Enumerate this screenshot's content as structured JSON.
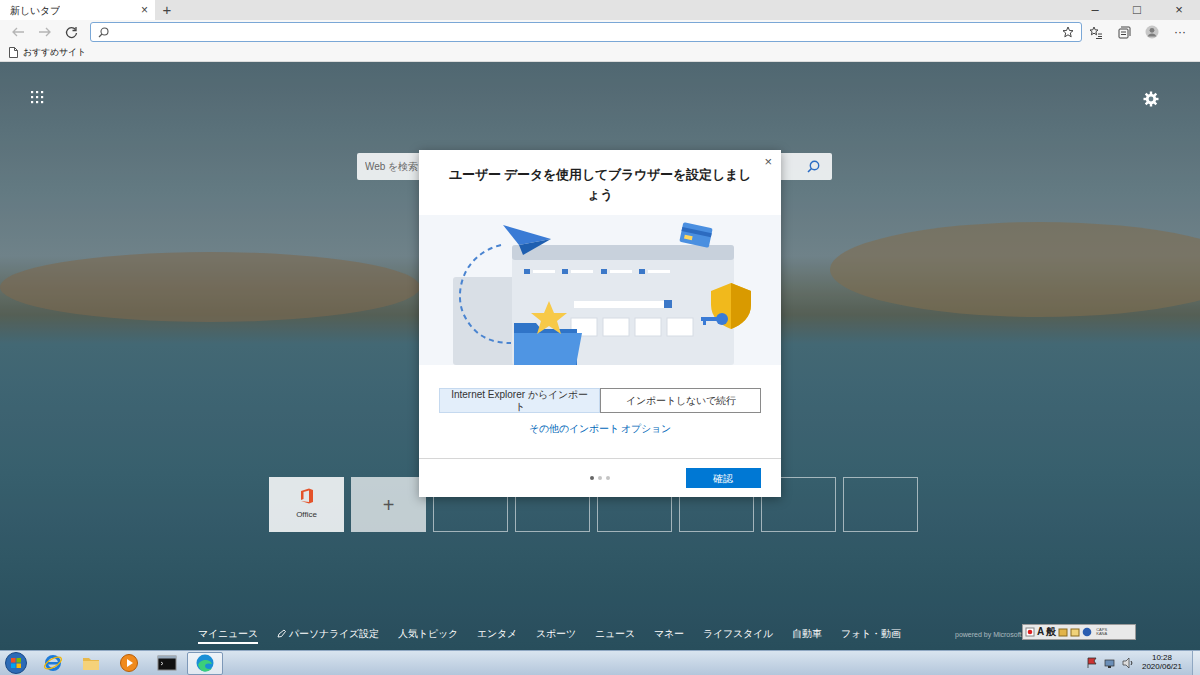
{
  "browser": {
    "tabs": [
      {
        "label": "新しいタブ",
        "selected": true,
        "close": "×"
      }
    ],
    "new_tab": "+",
    "window_controls": [
      "–",
      "□",
      "×"
    ],
    "toolbar_more": "···",
    "favorites": [
      "おすすめサイト"
    ]
  },
  "newtab": {
    "search": {
      "placeholder": "Web を検索"
    },
    "quick_links": [
      {
        "kind": "app",
        "label": "Office"
      },
      {
        "kind": "add",
        "label": "+"
      },
      {
        "kind": "empty"
      },
      {
        "kind": "empty"
      },
      {
        "kind": "empty"
      },
      {
        "kind": "empty"
      },
      {
        "kind": "empty"
      },
      {
        "kind": "empty"
      }
    ]
  },
  "dialog": {
    "title": "ユーザー データを使用してブラウザーを設定しましょう",
    "close": "×",
    "options": [
      {
        "label": "Internet Explorer からインポート",
        "selected": true
      },
      {
        "label": "インポートしないで続行",
        "selected": false
      }
    ],
    "link": "その他のインポート オプション",
    "steps": [
      {
        "active": true
      },
      {
        "active": false
      },
      {
        "active": false
      }
    ],
    "confirm": "確認"
  },
  "news_nav": {
    "items": [
      {
        "label": "マイニュース",
        "selected": true,
        "kind": "tab"
      },
      {
        "label": "パーソナライズ設定",
        "selected": false,
        "kind": "action"
      },
      {
        "label": "人気トピック",
        "selected": false,
        "kind": "tab"
      },
      {
        "label": "エンタメ",
        "selected": false,
        "kind": "tab"
      },
      {
        "label": "スポーツ",
        "selected": false,
        "kind": "tab"
      },
      {
        "label": "ニュース",
        "selected": false,
        "kind": "tab"
      },
      {
        "label": "マネー",
        "selected": false,
        "kind": "tab"
      },
      {
        "label": "ライフスタイル",
        "selected": false,
        "kind": "tab"
      },
      {
        "label": "自動車",
        "selected": false,
        "kind": "tab"
      },
      {
        "label": "フォト・動画",
        "selected": false,
        "kind": "tab"
      }
    ],
    "powered_by": "powered by Microsoft News"
  },
  "language_bar": {
    "items": [
      "A",
      "般"
    ],
    "caps": "CAPS",
    "kana": "KANA"
  },
  "taskbar": {
    "apps": [
      {
        "kind": "ie",
        "active": false
      },
      {
        "kind": "explorer",
        "active": false
      },
      {
        "kind": "media",
        "active": false
      },
      {
        "kind": "cmd",
        "active": false
      },
      {
        "kind": "edge",
        "active": true
      }
    ],
    "clock": {
      "time": "10:28",
      "date": "2020/06/21"
    }
  }
}
